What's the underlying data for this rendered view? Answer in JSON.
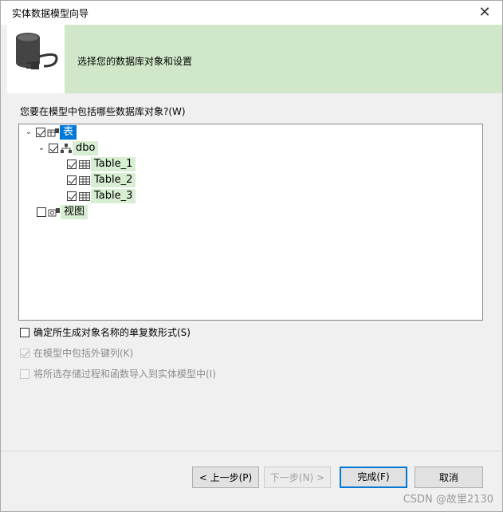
{
  "window": {
    "title": "实体数据模型向导",
    "close_glyph": "✕"
  },
  "banner": {
    "text": "选择您的数据库对象和设置"
  },
  "question": "您要在模型中包括哪些数据库对象?(W)",
  "tree": {
    "root_tables": {
      "label": "表",
      "checked": true,
      "expanded": true
    },
    "schema": {
      "label": "dbo",
      "checked": true,
      "expanded": true
    },
    "tables": [
      {
        "label": "Table_1",
        "checked": true
      },
      {
        "label": "Table_2",
        "checked": true
      },
      {
        "label": "Table_3",
        "checked": true
      }
    ],
    "root_views": {
      "label": "视图",
      "checked": false
    }
  },
  "options": [
    {
      "label": "确定所生成对象名称的单复数形式(S)",
      "checked": false,
      "enabled": true
    },
    {
      "label": "在模型中包括外键列(K)",
      "checked": true,
      "enabled": false
    },
    {
      "label": "将所选存储过程和函数导入到实体模型中(I)",
      "checked": false,
      "enabled": false
    }
  ],
  "buttons": {
    "back": "< 上一步(P)",
    "next": "下一步(N) >",
    "finish": "完成(F)",
    "cancel": "取消"
  },
  "watermark": "CSDN @故里2130"
}
